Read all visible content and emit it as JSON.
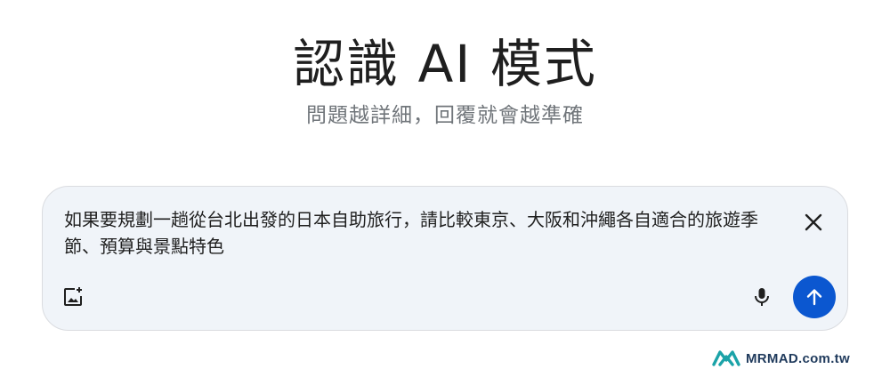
{
  "header": {
    "title": "認識 AI 模式",
    "subtitle": "問題越詳細，回覆就會越準確"
  },
  "search": {
    "query": "如果要規劃一趟從台北出發的日本自助旅行，請比較東京、大阪和沖繩各自適合的旅遊季節、預算與景點特色",
    "icons": {
      "close": "close-icon",
      "add_image": "add-image-icon",
      "microphone": "microphone-icon",
      "send": "arrow-up-icon"
    },
    "colors": {
      "box_background": "#f0f4f9",
      "send_button": "#0b57d0"
    }
  },
  "watermark": {
    "text": "MRMAD.com.tw",
    "logo": "mrmad-logo",
    "logo_color": "#1ba3a8"
  }
}
